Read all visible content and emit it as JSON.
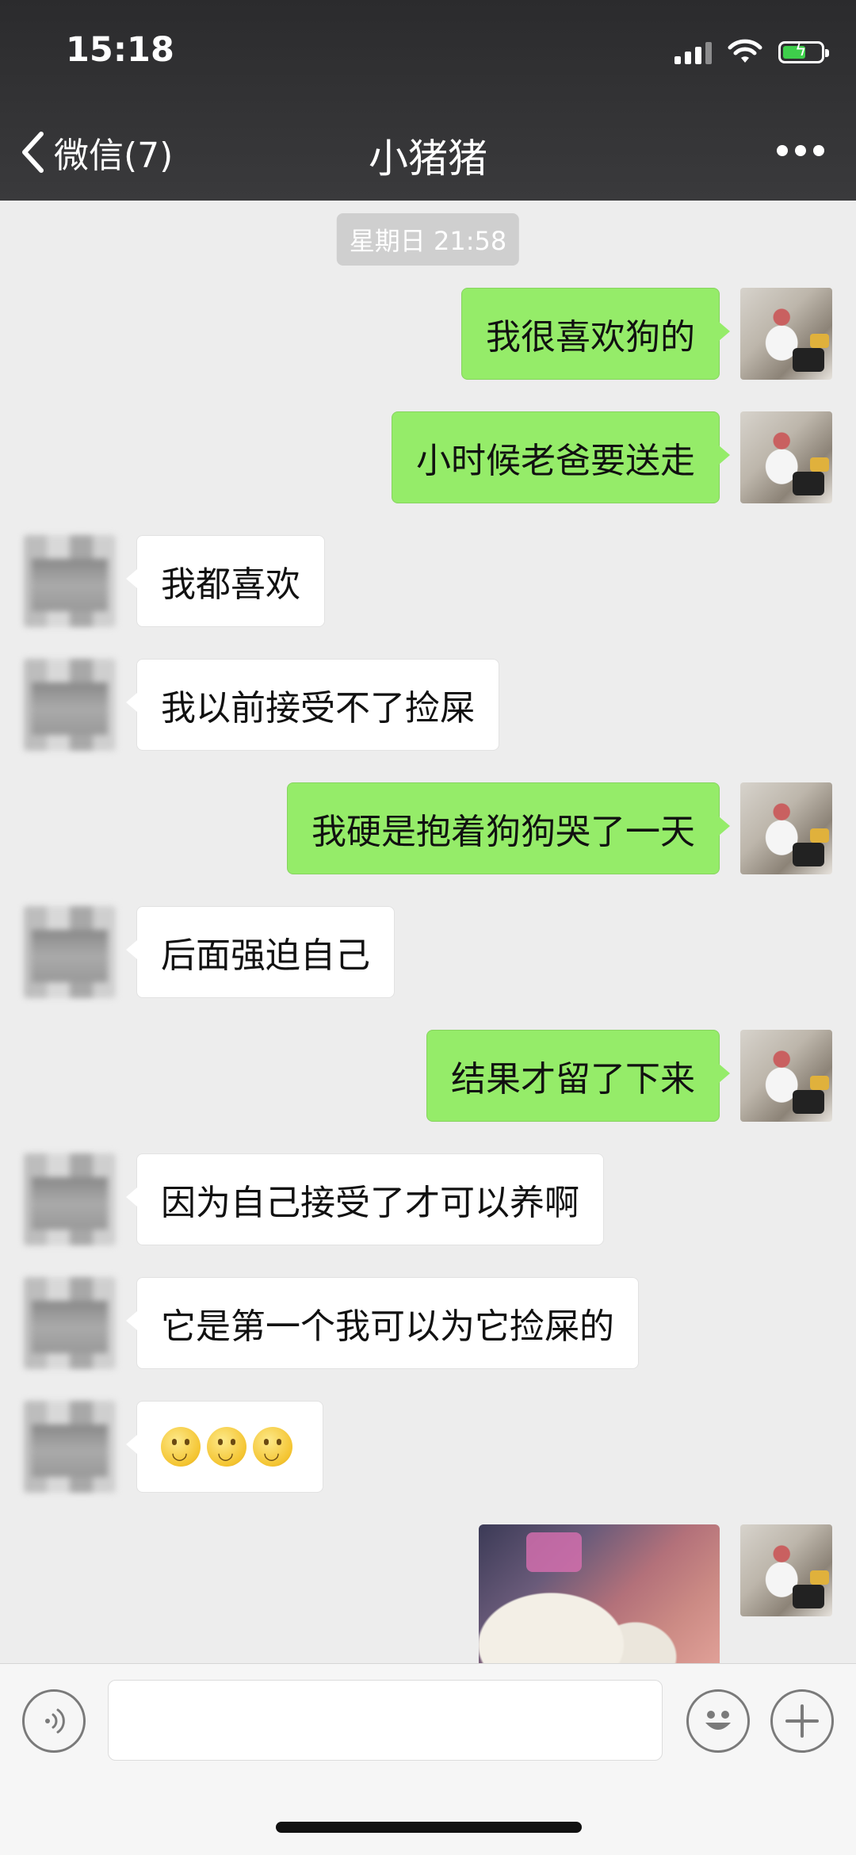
{
  "status_bar": {
    "time": "15:18"
  },
  "nav": {
    "back_label": "微信(7)",
    "title": "小猪猪"
  },
  "chat": {
    "timestamp": "星期日 21:58",
    "messages": [
      {
        "from": "me",
        "text": "我很喜欢狗的"
      },
      {
        "from": "me",
        "text": "小时候老爸要送走"
      },
      {
        "from": "other",
        "text": "我都喜欢"
      },
      {
        "from": "other",
        "text": "我以前接受不了捡屎"
      },
      {
        "from": "me",
        "text": "我硬是抱着狗狗哭了一天"
      },
      {
        "from": "other",
        "text": "后面强迫自己"
      },
      {
        "from": "me",
        "text": "结果才留了下来"
      },
      {
        "from": "other",
        "text": "因为自己接受了才可以养啊"
      },
      {
        "from": "other",
        "text": "它是第一个我可以为它捡屎的"
      },
      {
        "from": "other",
        "emoji": [
          "smile-emoji",
          "smile-emoji",
          "smile-emoji"
        ]
      },
      {
        "from": "me",
        "image": "dogs-photo"
      }
    ]
  },
  "input_bar": {
    "value": "",
    "icons": [
      "voice-icon",
      "emoji-face-icon",
      "plus-icon"
    ]
  },
  "colors": {
    "my_bubble": "#95ec69",
    "other_bubble": "#ffffff",
    "chat_bg": "#ededed",
    "nav_bg": "#2b2b2d"
  }
}
